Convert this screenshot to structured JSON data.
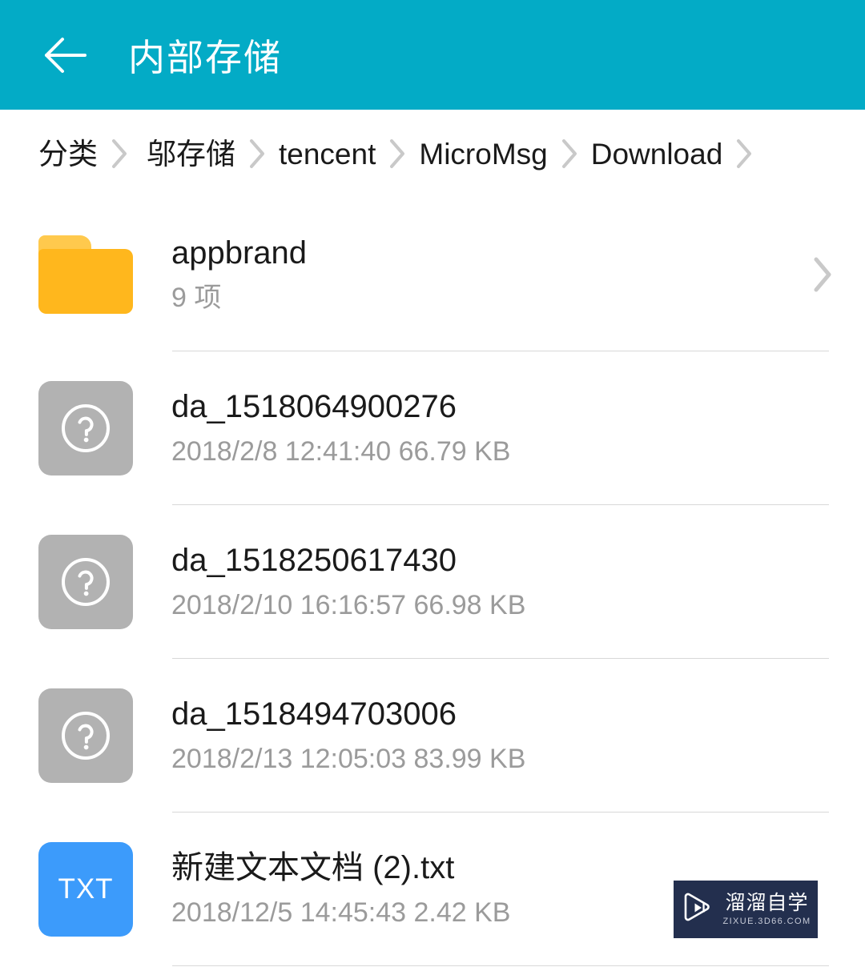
{
  "theme": {
    "appbar_bg": "#03abc6",
    "page_bg": "#ffffff",
    "folder_color": "#ffb71d",
    "unknown_icon_color": "#b2b2b2",
    "txt_icon_color": "#3c9bfb",
    "divider_color": "#d8d8d8",
    "primary_text": "#1a1a1a",
    "secondary_text": "#9b9b9b",
    "watermark_bg": "#232f4e"
  },
  "appbar": {
    "back_icon": "arrow-left-icon",
    "title": "内部存储"
  },
  "breadcrumb": {
    "separator_icon": "chevron-right-icon",
    "items": [
      {
        "label": "分类"
      },
      {
        "label": "邬存储"
      },
      {
        "label": "tencent"
      },
      {
        "label": "MicroMsg"
      },
      {
        "label": "Download"
      }
    ]
  },
  "file_list": {
    "rows": [
      {
        "icon": "folder-icon",
        "icon_type": "folder",
        "name": "appbrand",
        "meta": "9 项",
        "has_chevron": true,
        "chevron_icon": "chevron-right-icon"
      },
      {
        "icon": "unknown-file-icon",
        "icon_type": "unknown",
        "icon_glyph": "?",
        "name": "da_1518064900276",
        "meta": "2018/2/8 12:41:40 66.79 KB",
        "has_chevron": false
      },
      {
        "icon": "unknown-file-icon",
        "icon_type": "unknown",
        "icon_glyph": "?",
        "name": "da_1518250617430",
        "meta": "2018/2/10 16:16:57 66.98 KB",
        "has_chevron": false
      },
      {
        "icon": "unknown-file-icon",
        "icon_type": "unknown",
        "icon_glyph": "?",
        "name": "da_1518494703006",
        "meta": "2018/2/13 12:05:03 83.99 KB",
        "has_chevron": false
      },
      {
        "icon": "txt-file-icon",
        "icon_type": "txt",
        "icon_label": "TXT",
        "name": "新建文本文档 (2).txt",
        "meta": "2018/12/5 14:45:43 2.42 KB",
        "has_chevron": false
      }
    ]
  },
  "watermark": {
    "logo_icon": "play-button-icon",
    "title": "溜溜自学",
    "subtitle": "ZIXUE.3D66.COM"
  }
}
